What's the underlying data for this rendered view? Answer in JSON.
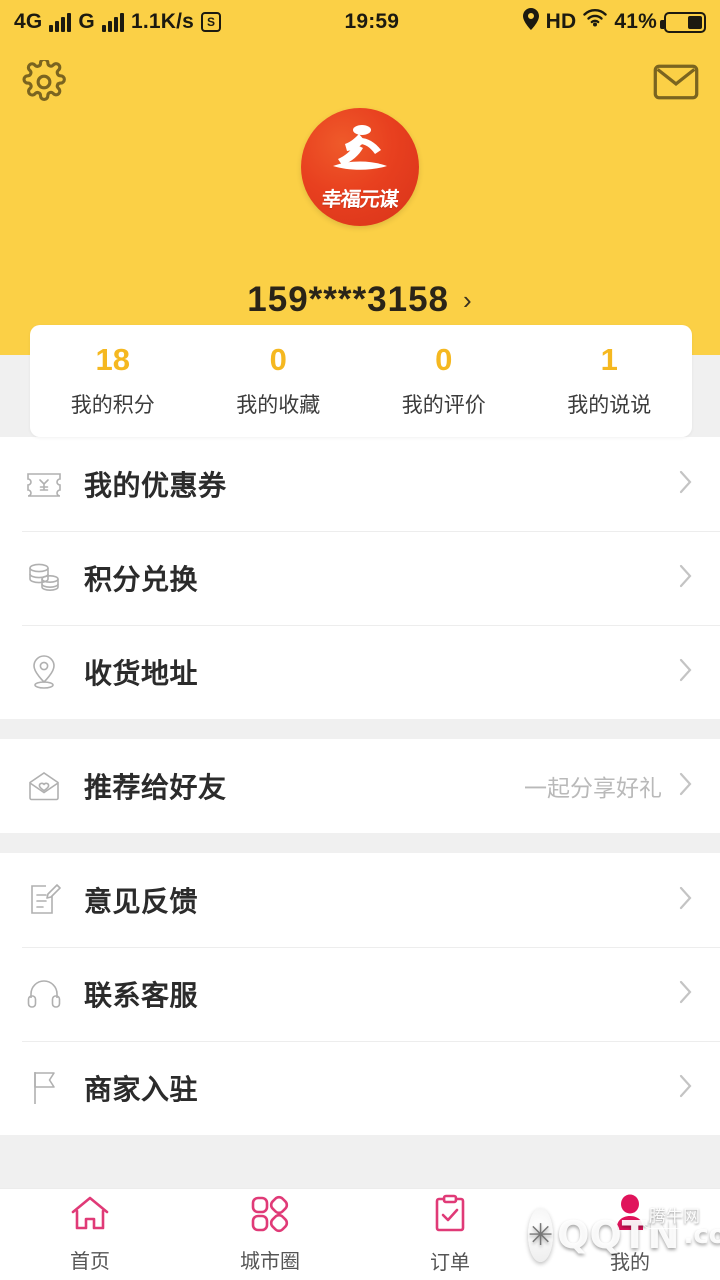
{
  "statusbar": {
    "network_type": "4G",
    "carrier_second": "G",
    "data_rate": "1.1K/s",
    "sim_badge": "S",
    "time": "19:59",
    "hd_label": "HD",
    "battery_percent": "41%",
    "location_icon": "location-pin-icon",
    "wifi_icon": "wifi-icon",
    "battery_icon": "battery-icon"
  },
  "header": {
    "settings_icon": "gear-icon",
    "message_icon": "envelope-icon",
    "logo_text": "幸福元谋",
    "logo_alt": "brand-logo",
    "phone": "159****3158",
    "phone_chevron": "›",
    "bg_color": "#fbd046"
  },
  "stats": [
    {
      "value": "18",
      "label": "我的积分"
    },
    {
      "value": "0",
      "label": "我的收藏"
    },
    {
      "value": "0",
      "label": "我的评价"
    },
    {
      "value": "1",
      "label": "我的说说"
    }
  ],
  "menu_groups": [
    {
      "items": [
        {
          "label": "我的优惠券",
          "icon": "coupon-icon",
          "hint": ""
        },
        {
          "label": "积分兑换",
          "icon": "coins-icon",
          "hint": ""
        },
        {
          "label": "收货地址",
          "icon": "location-pin-icon",
          "hint": ""
        }
      ]
    },
    {
      "items": [
        {
          "label": "推荐给好友",
          "icon": "envelope-heart-icon",
          "hint": "一起分享好礼"
        }
      ]
    },
    {
      "items": [
        {
          "label": "意见反馈",
          "icon": "feedback-edit-icon",
          "hint": ""
        },
        {
          "label": "联系客服",
          "icon": "headset-icon",
          "hint": ""
        },
        {
          "label": "商家入驻",
          "icon": "flag-icon",
          "hint": ""
        }
      ]
    }
  ],
  "tabs": [
    {
      "label": "首页",
      "icon": "home-icon",
      "active": false
    },
    {
      "label": "城市圈",
      "icon": "clover-icon",
      "active": false
    },
    {
      "label": "订单",
      "icon": "clipboard-check-icon",
      "active": false
    },
    {
      "label": "我的",
      "icon": "person-icon",
      "active": true
    }
  ],
  "watermarks": {
    "site": "QQTN",
    "site_suffix": ".com",
    "site_cn": "腾牛网"
  },
  "colors": {
    "brand_yellow": "#fbd046",
    "accent_number": "#f5b820",
    "tab_pink": "#e03a77",
    "page_bg": "#f0f0f0",
    "logo_red": "#e8401f"
  }
}
